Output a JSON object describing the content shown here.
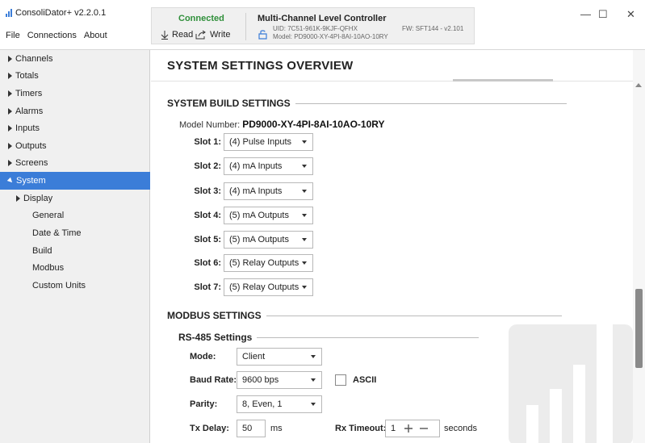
{
  "app": {
    "title": "ConsoliDator+ v2.2.0.1",
    "menu": [
      "File",
      "Connections",
      "About"
    ]
  },
  "connection": {
    "status": "Connected",
    "status_color": "#2f8f3a",
    "read_label": "Read",
    "write_label": "Write",
    "device_name": "Multi-Channel Level Controller",
    "uid": "UID: 7C51-961K-9KJF-QFHX",
    "model": "Model: PD9000-XY-4PI-8AI-10AO-10RY",
    "firmware": "FW: SFT144 - v2.101"
  },
  "window_controls": {
    "minimize": "—",
    "maximize": "☐",
    "close": "✕"
  },
  "sidebar": {
    "items": [
      {
        "label": "Channels",
        "icon": "triangle-right-icon"
      },
      {
        "label": "Totals",
        "icon": "triangle-right-icon"
      },
      {
        "label": "Timers",
        "icon": "triangle-right-icon"
      },
      {
        "label": "Alarms",
        "icon": "triangle-right-icon"
      },
      {
        "label": "Inputs",
        "icon": "triangle-right-icon"
      },
      {
        "label": "Outputs",
        "icon": "triangle-right-icon"
      },
      {
        "label": "Screens",
        "icon": "triangle-right-icon"
      },
      {
        "label": "System",
        "icon": "triangle-down-icon",
        "active": true
      },
      {
        "label": "Display",
        "icon": "triangle-right-icon"
      },
      {
        "label": "General"
      },
      {
        "label": "Date & Time"
      },
      {
        "label": "Build"
      },
      {
        "label": "Modbus"
      },
      {
        "label": "Custom Units"
      }
    ],
    "accent": "#3b7dd8"
  },
  "main": {
    "page_title": "SYSTEM SETTINGS OVERVIEW",
    "build": {
      "section_title": "SYSTEM BUILD SETTINGS",
      "model_label": "Model Number:",
      "model_value": "PD9000-XY-4PI-8AI-10AO-10RY",
      "slots": [
        {
          "label": "Slot 1:",
          "value": "(4) Pulse Inputs"
        },
        {
          "label": "Slot 2:",
          "value": "(4) mA Inputs"
        },
        {
          "label": "Slot 3:",
          "value": "(4) mA Inputs"
        },
        {
          "label": "Slot 4:",
          "value": "(5) mA Outputs"
        },
        {
          "label": "Slot 5:",
          "value": "(5) mA Outputs"
        },
        {
          "label": "Slot 6:",
          "value": "(5) Relay Outputs"
        },
        {
          "label": "Slot 7:",
          "value": "(5) Relay Outputs"
        }
      ]
    },
    "modbus": {
      "section_title": "MODBUS SETTINGS",
      "rs485_title": "RS-485 Settings",
      "mode_label": "Mode:",
      "mode_value": "Client",
      "baud_label": "Baud Rate:",
      "baud_value": "9600 bps",
      "ascii_label": "ASCII",
      "parity_label": "Parity:",
      "parity_value": "8, Even, 1",
      "tx_delay_label": "Tx Delay:",
      "tx_delay_value": "50",
      "tx_delay_unit": "ms",
      "rx_timeout_label": "Rx Timeout:",
      "rx_timeout_value": "1",
      "rx_timeout_unit": "seconds"
    }
  }
}
